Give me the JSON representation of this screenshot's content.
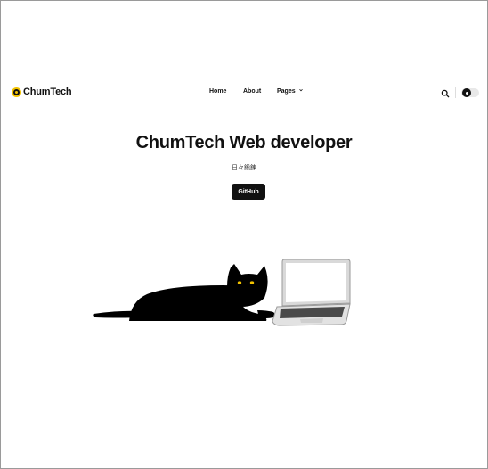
{
  "brand": {
    "name": "ChumTech",
    "logo_icon": "chumtech-logo-icon"
  },
  "nav": {
    "home": "Home",
    "about": "About",
    "pages": "Pages"
  },
  "header_icons": {
    "search": "search-icon",
    "theme_toggle": "theme-toggle"
  },
  "hero": {
    "title": "ChumTech Web developer",
    "subtitle": "日々鍛錬",
    "button": "GitHub"
  },
  "colors": {
    "accent": "#f2c200",
    "text": "#111111",
    "background": "#ffffff"
  }
}
